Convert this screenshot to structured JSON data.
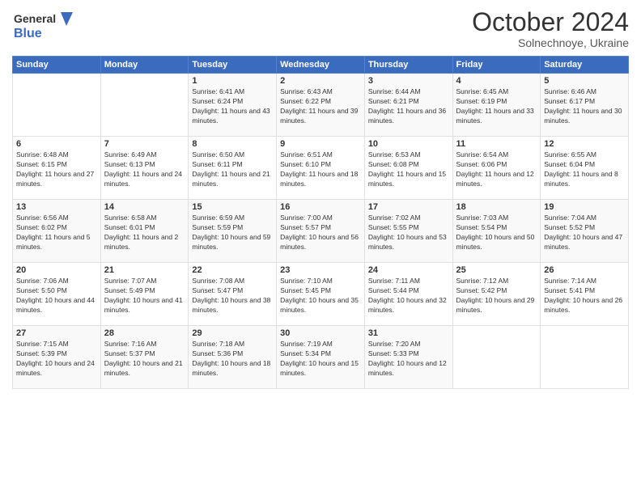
{
  "header": {
    "logo_line1": "General",
    "logo_line2": "Blue",
    "month": "October 2024",
    "location": "Solnechnoye, Ukraine"
  },
  "weekdays": [
    "Sunday",
    "Monday",
    "Tuesday",
    "Wednesday",
    "Thursday",
    "Friday",
    "Saturday"
  ],
  "weeks": [
    [
      {
        "day": "",
        "info": ""
      },
      {
        "day": "",
        "info": ""
      },
      {
        "day": "1",
        "info": "Sunrise: 6:41 AM\nSunset: 6:24 PM\nDaylight: 11 hours and 43 minutes."
      },
      {
        "day": "2",
        "info": "Sunrise: 6:43 AM\nSunset: 6:22 PM\nDaylight: 11 hours and 39 minutes."
      },
      {
        "day": "3",
        "info": "Sunrise: 6:44 AM\nSunset: 6:21 PM\nDaylight: 11 hours and 36 minutes."
      },
      {
        "day": "4",
        "info": "Sunrise: 6:45 AM\nSunset: 6:19 PM\nDaylight: 11 hours and 33 minutes."
      },
      {
        "day": "5",
        "info": "Sunrise: 6:46 AM\nSunset: 6:17 PM\nDaylight: 11 hours and 30 minutes."
      }
    ],
    [
      {
        "day": "6",
        "info": "Sunrise: 6:48 AM\nSunset: 6:15 PM\nDaylight: 11 hours and 27 minutes."
      },
      {
        "day": "7",
        "info": "Sunrise: 6:49 AM\nSunset: 6:13 PM\nDaylight: 11 hours and 24 minutes."
      },
      {
        "day": "8",
        "info": "Sunrise: 6:50 AM\nSunset: 6:11 PM\nDaylight: 11 hours and 21 minutes."
      },
      {
        "day": "9",
        "info": "Sunrise: 6:51 AM\nSunset: 6:10 PM\nDaylight: 11 hours and 18 minutes."
      },
      {
        "day": "10",
        "info": "Sunrise: 6:53 AM\nSunset: 6:08 PM\nDaylight: 11 hours and 15 minutes."
      },
      {
        "day": "11",
        "info": "Sunrise: 6:54 AM\nSunset: 6:06 PM\nDaylight: 11 hours and 12 minutes."
      },
      {
        "day": "12",
        "info": "Sunrise: 6:55 AM\nSunset: 6:04 PM\nDaylight: 11 hours and 8 minutes."
      }
    ],
    [
      {
        "day": "13",
        "info": "Sunrise: 6:56 AM\nSunset: 6:02 PM\nDaylight: 11 hours and 5 minutes."
      },
      {
        "day": "14",
        "info": "Sunrise: 6:58 AM\nSunset: 6:01 PM\nDaylight: 11 hours and 2 minutes."
      },
      {
        "day": "15",
        "info": "Sunrise: 6:59 AM\nSunset: 5:59 PM\nDaylight: 10 hours and 59 minutes."
      },
      {
        "day": "16",
        "info": "Sunrise: 7:00 AM\nSunset: 5:57 PM\nDaylight: 10 hours and 56 minutes."
      },
      {
        "day": "17",
        "info": "Sunrise: 7:02 AM\nSunset: 5:55 PM\nDaylight: 10 hours and 53 minutes."
      },
      {
        "day": "18",
        "info": "Sunrise: 7:03 AM\nSunset: 5:54 PM\nDaylight: 10 hours and 50 minutes."
      },
      {
        "day": "19",
        "info": "Sunrise: 7:04 AM\nSunset: 5:52 PM\nDaylight: 10 hours and 47 minutes."
      }
    ],
    [
      {
        "day": "20",
        "info": "Sunrise: 7:06 AM\nSunset: 5:50 PM\nDaylight: 10 hours and 44 minutes."
      },
      {
        "day": "21",
        "info": "Sunrise: 7:07 AM\nSunset: 5:49 PM\nDaylight: 10 hours and 41 minutes."
      },
      {
        "day": "22",
        "info": "Sunrise: 7:08 AM\nSunset: 5:47 PM\nDaylight: 10 hours and 38 minutes."
      },
      {
        "day": "23",
        "info": "Sunrise: 7:10 AM\nSunset: 5:45 PM\nDaylight: 10 hours and 35 minutes."
      },
      {
        "day": "24",
        "info": "Sunrise: 7:11 AM\nSunset: 5:44 PM\nDaylight: 10 hours and 32 minutes."
      },
      {
        "day": "25",
        "info": "Sunrise: 7:12 AM\nSunset: 5:42 PM\nDaylight: 10 hours and 29 minutes."
      },
      {
        "day": "26",
        "info": "Sunrise: 7:14 AM\nSunset: 5:41 PM\nDaylight: 10 hours and 26 minutes."
      }
    ],
    [
      {
        "day": "27",
        "info": "Sunrise: 7:15 AM\nSunset: 5:39 PM\nDaylight: 10 hours and 24 minutes."
      },
      {
        "day": "28",
        "info": "Sunrise: 7:16 AM\nSunset: 5:37 PM\nDaylight: 10 hours and 21 minutes."
      },
      {
        "day": "29",
        "info": "Sunrise: 7:18 AM\nSunset: 5:36 PM\nDaylight: 10 hours and 18 minutes."
      },
      {
        "day": "30",
        "info": "Sunrise: 7:19 AM\nSunset: 5:34 PM\nDaylight: 10 hours and 15 minutes."
      },
      {
        "day": "31",
        "info": "Sunrise: 7:20 AM\nSunset: 5:33 PM\nDaylight: 10 hours and 12 minutes."
      },
      {
        "day": "",
        "info": ""
      },
      {
        "day": "",
        "info": ""
      }
    ]
  ]
}
